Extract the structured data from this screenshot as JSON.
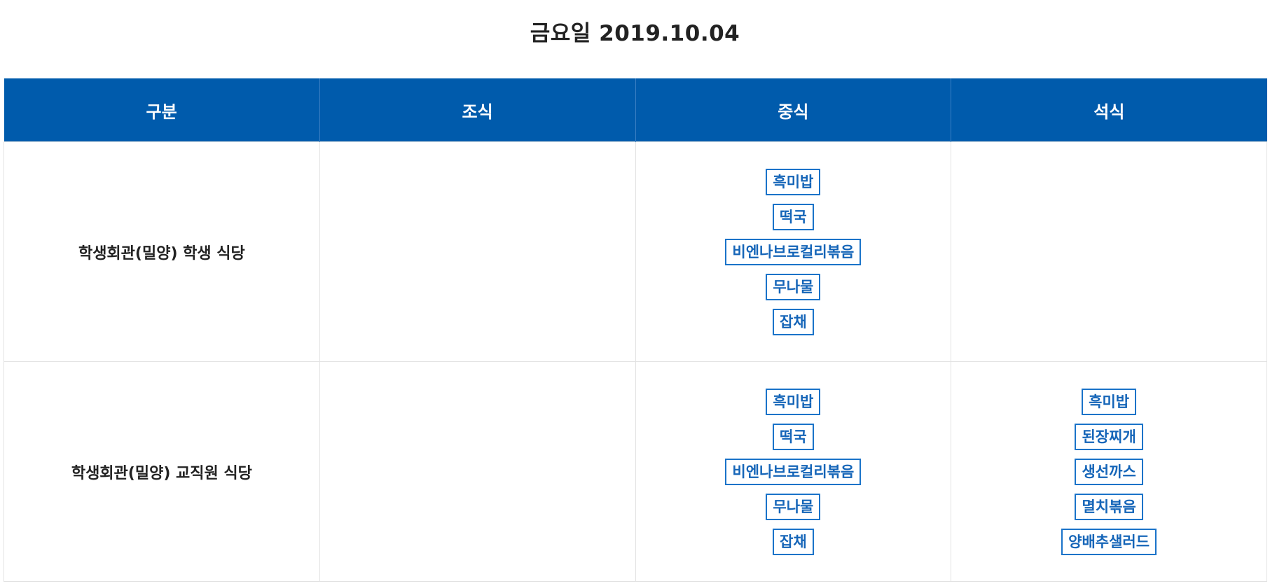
{
  "title": "금요일 2019.10.04",
  "colors": {
    "header_bg": "#005bac",
    "header_text": "#ffffff",
    "menu_border": "#1a73c9",
    "menu_text": "#1565b8"
  },
  "columns": [
    "구분",
    "조식",
    "중식",
    "석식"
  ],
  "rows": [
    {
      "label": "학생회관(밀양) 학생 식당",
      "breakfast": [],
      "lunch": [
        "흑미밥",
        "떡국",
        "비엔나브로컬리볶음",
        "무나물",
        "잡채"
      ],
      "dinner": []
    },
    {
      "label": "학생회관(밀양) 교직원 식당",
      "breakfast": [],
      "lunch": [
        "흑미밥",
        "떡국",
        "비엔나브로컬리볶음",
        "무나물",
        "잡채"
      ],
      "dinner": [
        "흑미밥",
        "된장찌개",
        "생선까스",
        "멸치볶음",
        "양배추샐러드"
      ]
    }
  ]
}
